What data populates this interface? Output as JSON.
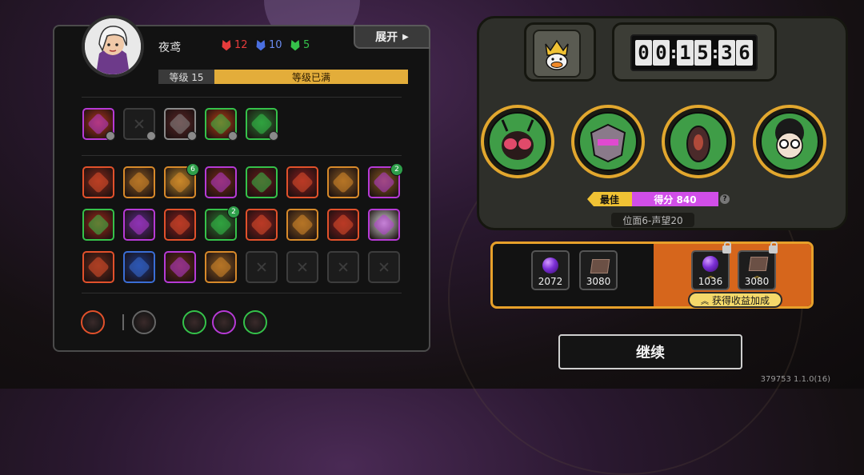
{
  "player": {
    "name": "夜鸢",
    "level_label": "等级 15",
    "level_status": "等级已满",
    "expand_label": "展开",
    "gems": [
      {
        "icon": "red-gem-icon",
        "color": "#e63b3b",
        "value": "12"
      },
      {
        "icon": "blue-gem-icon",
        "color": "#4a6fe0",
        "value": "10"
      },
      {
        "icon": "green-gem-icon",
        "color": "#35c24a",
        "value": "5"
      }
    ]
  },
  "equipped_skills": [
    {
      "icon": "explosion-skill-icon",
      "border": "#b73ad6",
      "bg": "#b2361c"
    },
    {
      "icon": "empty-slot",
      "border": "#3d3d3d",
      "bg": "#1c1c1c"
    },
    {
      "icon": "vortex-skill-icon",
      "border": "#8a8a8a",
      "bg": "#5a2626"
    },
    {
      "icon": "fire-skill-icon",
      "border": "#35c24a",
      "bg": "#b74016"
    },
    {
      "icon": "green-beast-skill-icon",
      "border": "#35c24a",
      "bg": "#2a7a32"
    }
  ],
  "passives": {
    "rows": [
      [
        {
          "icon": "fist-icon",
          "border": "#e2512b",
          "bg": "#8a2a1a"
        },
        {
          "icon": "compass-icon",
          "border": "#d88a2a",
          "bg": "#8a5a22"
        },
        {
          "icon": "sunrise-icon",
          "border": "#d88a2a",
          "bg": "#b8862a",
          "badge": "6"
        },
        {
          "icon": "arrows-icon",
          "border": "#b73ad6",
          "bg": "#7a2a1a"
        },
        {
          "icon": "demon-icon",
          "border": "#35c24a",
          "bg": "#6a1a1a"
        },
        {
          "icon": "claw-icon",
          "border": "#e2512b",
          "bg": "#8a1e1e"
        },
        {
          "icon": "spear-icon",
          "border": "#d88a2a",
          "bg": "#8a5a22"
        },
        {
          "icon": "eye-ring-icon",
          "border": "#b73ad6",
          "bg": "#8a5a22",
          "badge": "2"
        }
      ],
      [
        {
          "icon": "slash-icon",
          "border": "#35c24a",
          "bg": "#a02a1a"
        },
        {
          "icon": "skull-cloud-icon",
          "border": "#b73ad6",
          "bg": "#5a2a8a"
        },
        {
          "icon": "bullets-icon",
          "border": "#e2512b",
          "bg": "#8a1e1e"
        },
        {
          "icon": "hooded-figure-icon",
          "border": "#35c24a",
          "bg": "#2a7a32",
          "badge": "2"
        },
        {
          "icon": "spiral-icon",
          "border": "#e2512b",
          "bg": "#8a1e1e"
        },
        {
          "icon": "crown-spikes-icon",
          "border": "#d88a2a",
          "bg": "#8a5a22"
        },
        {
          "icon": "claw-marks-icon",
          "border": "#e2512b",
          "bg": "#8a1e1e"
        },
        {
          "icon": "burst-icon",
          "border": "#b73ad6",
          "bg": "#d8d8d8"
        }
      ],
      [
        {
          "icon": "blades-icon",
          "border": "#e2512b",
          "bg": "#6a2a1a"
        },
        {
          "icon": "shield-icon",
          "border": "#3a6ed6",
          "bg": "#1a3a8a"
        },
        {
          "icon": "crossed-swords-icon",
          "border": "#b73ad6",
          "bg": "#6a2a1a"
        },
        {
          "icon": "crystals-icon",
          "border": "#d88a2a",
          "bg": "#8a5a22"
        },
        {
          "icon": "empty-slot",
          "border": "#3d3d3d",
          "bg": "#1c1c1c"
        },
        {
          "icon": "empty-slot",
          "border": "#3d3d3d",
          "bg": "#1c1c1c"
        },
        {
          "icon": "empty-slot",
          "border": "#3d3d3d",
          "bg": "#1c1c1c"
        },
        {
          "icon": "empty-slot",
          "border": "#3d3d3d",
          "bg": "#1c1c1c"
        }
      ]
    ]
  },
  "bottom_row": [
    {
      "icon": "target-cross-icon",
      "border": "#e2512b"
    },
    {
      "icon": "pistol-icon",
      "border": "#666666"
    },
    {
      "icon": "ring-icon",
      "border": "#35c24a"
    },
    {
      "icon": "fist-red-icon",
      "border": "#b73ad6"
    },
    {
      "icon": "claw-green-icon",
      "border": "#35c24a"
    }
  ],
  "timer": {
    "digits": [
      "0",
      "0",
      "1",
      "5",
      "3",
      "6"
    ]
  },
  "bosses": [
    {
      "icon": "mantis-boss-icon"
    },
    {
      "icon": "robot-boss-icon"
    },
    {
      "icon": "alien-boss-icon"
    },
    {
      "icon": "glasses-boy-boss-icon"
    }
  ],
  "score": {
    "best_label": "最佳",
    "score_text": "得分 840",
    "help": "?",
    "stage_text": "位面6-声望20"
  },
  "rewards": {
    "base": [
      {
        "icon": "purple-orb-icon",
        "value": "2072"
      },
      {
        "icon": "card-icon",
        "value": "3080"
      }
    ],
    "boosted": [
      {
        "icon": "purple-orb-icon",
        "value": "1036"
      },
      {
        "icon": "card-icon",
        "value": "3080"
      }
    ],
    "bonus_label": "获得收益加成",
    "colors": {
      "frame": "#e7a02a",
      "boost_bg": "#d6661c"
    }
  },
  "continue_label": "继续",
  "version": "379753 1.1.0(16)"
}
